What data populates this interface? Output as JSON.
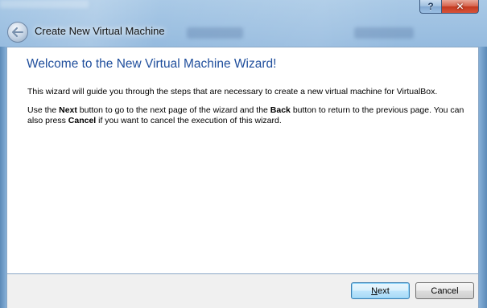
{
  "window": {
    "help_button": "?",
    "close_button": "✕"
  },
  "wizard": {
    "title": "Create New Virtual Machine",
    "heading": "Welcome to the New Virtual Machine Wizard!",
    "intro": "This wizard will guide you through the steps that are necessary to create a new virtual machine for VirtualBox.",
    "instructions": {
      "part1": "Use the ",
      "next_word": "Next",
      "part2": " button to go to the next page of the wizard and the ",
      "back_word": "Back",
      "part3": " button to return to the previous page. You can also press ",
      "cancel_word": "Cancel",
      "part4": " if you want to cancel the execution of this wizard."
    }
  },
  "buttons": {
    "next_mnemonic": "N",
    "next_rest": "ext",
    "cancel": "Cancel"
  },
  "colors": {
    "heading": "#1f4e9c",
    "frame": "#79a5d0",
    "close": "#c23a20"
  },
  "icons": {
    "back": "back-arrow-icon",
    "help": "question-mark-icon",
    "close": "close-icon"
  }
}
